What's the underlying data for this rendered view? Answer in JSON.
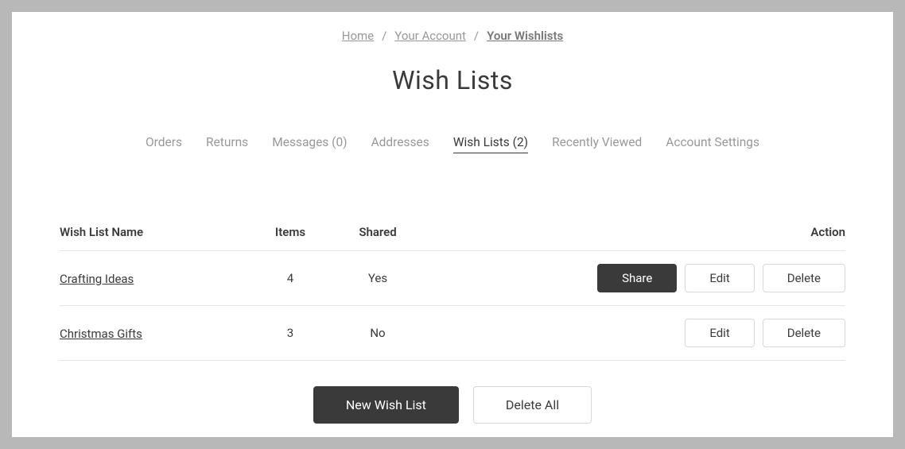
{
  "breadcrumb": {
    "items": [
      {
        "label": "Home",
        "current": false
      },
      {
        "label": "Your Account",
        "current": false
      },
      {
        "label": "Your Wishlists",
        "current": true
      }
    ]
  },
  "page_title": "Wish Lists",
  "tabs": [
    {
      "label": "Orders",
      "active": false
    },
    {
      "label": "Returns",
      "active": false
    },
    {
      "label": "Messages (0)",
      "active": false
    },
    {
      "label": "Addresses",
      "active": false
    },
    {
      "label": "Wish Lists (2)",
      "active": true
    },
    {
      "label": "Recently Viewed",
      "active": false
    },
    {
      "label": "Account Settings",
      "active": false
    }
  ],
  "table": {
    "headers": {
      "name": "Wish List Name",
      "items": "Items",
      "shared": "Shared",
      "action": "Action"
    },
    "rows": [
      {
        "name": "Crafting Ideas",
        "items": "4",
        "shared": "Yes",
        "has_share": true
      },
      {
        "name": "Christmas Gifts",
        "items": "3",
        "shared": "No",
        "has_share": false
      }
    ]
  },
  "buttons": {
    "share": "Share",
    "edit": "Edit",
    "delete": "Delete",
    "new_wish_list": "New Wish List",
    "delete_all": "Delete All"
  }
}
